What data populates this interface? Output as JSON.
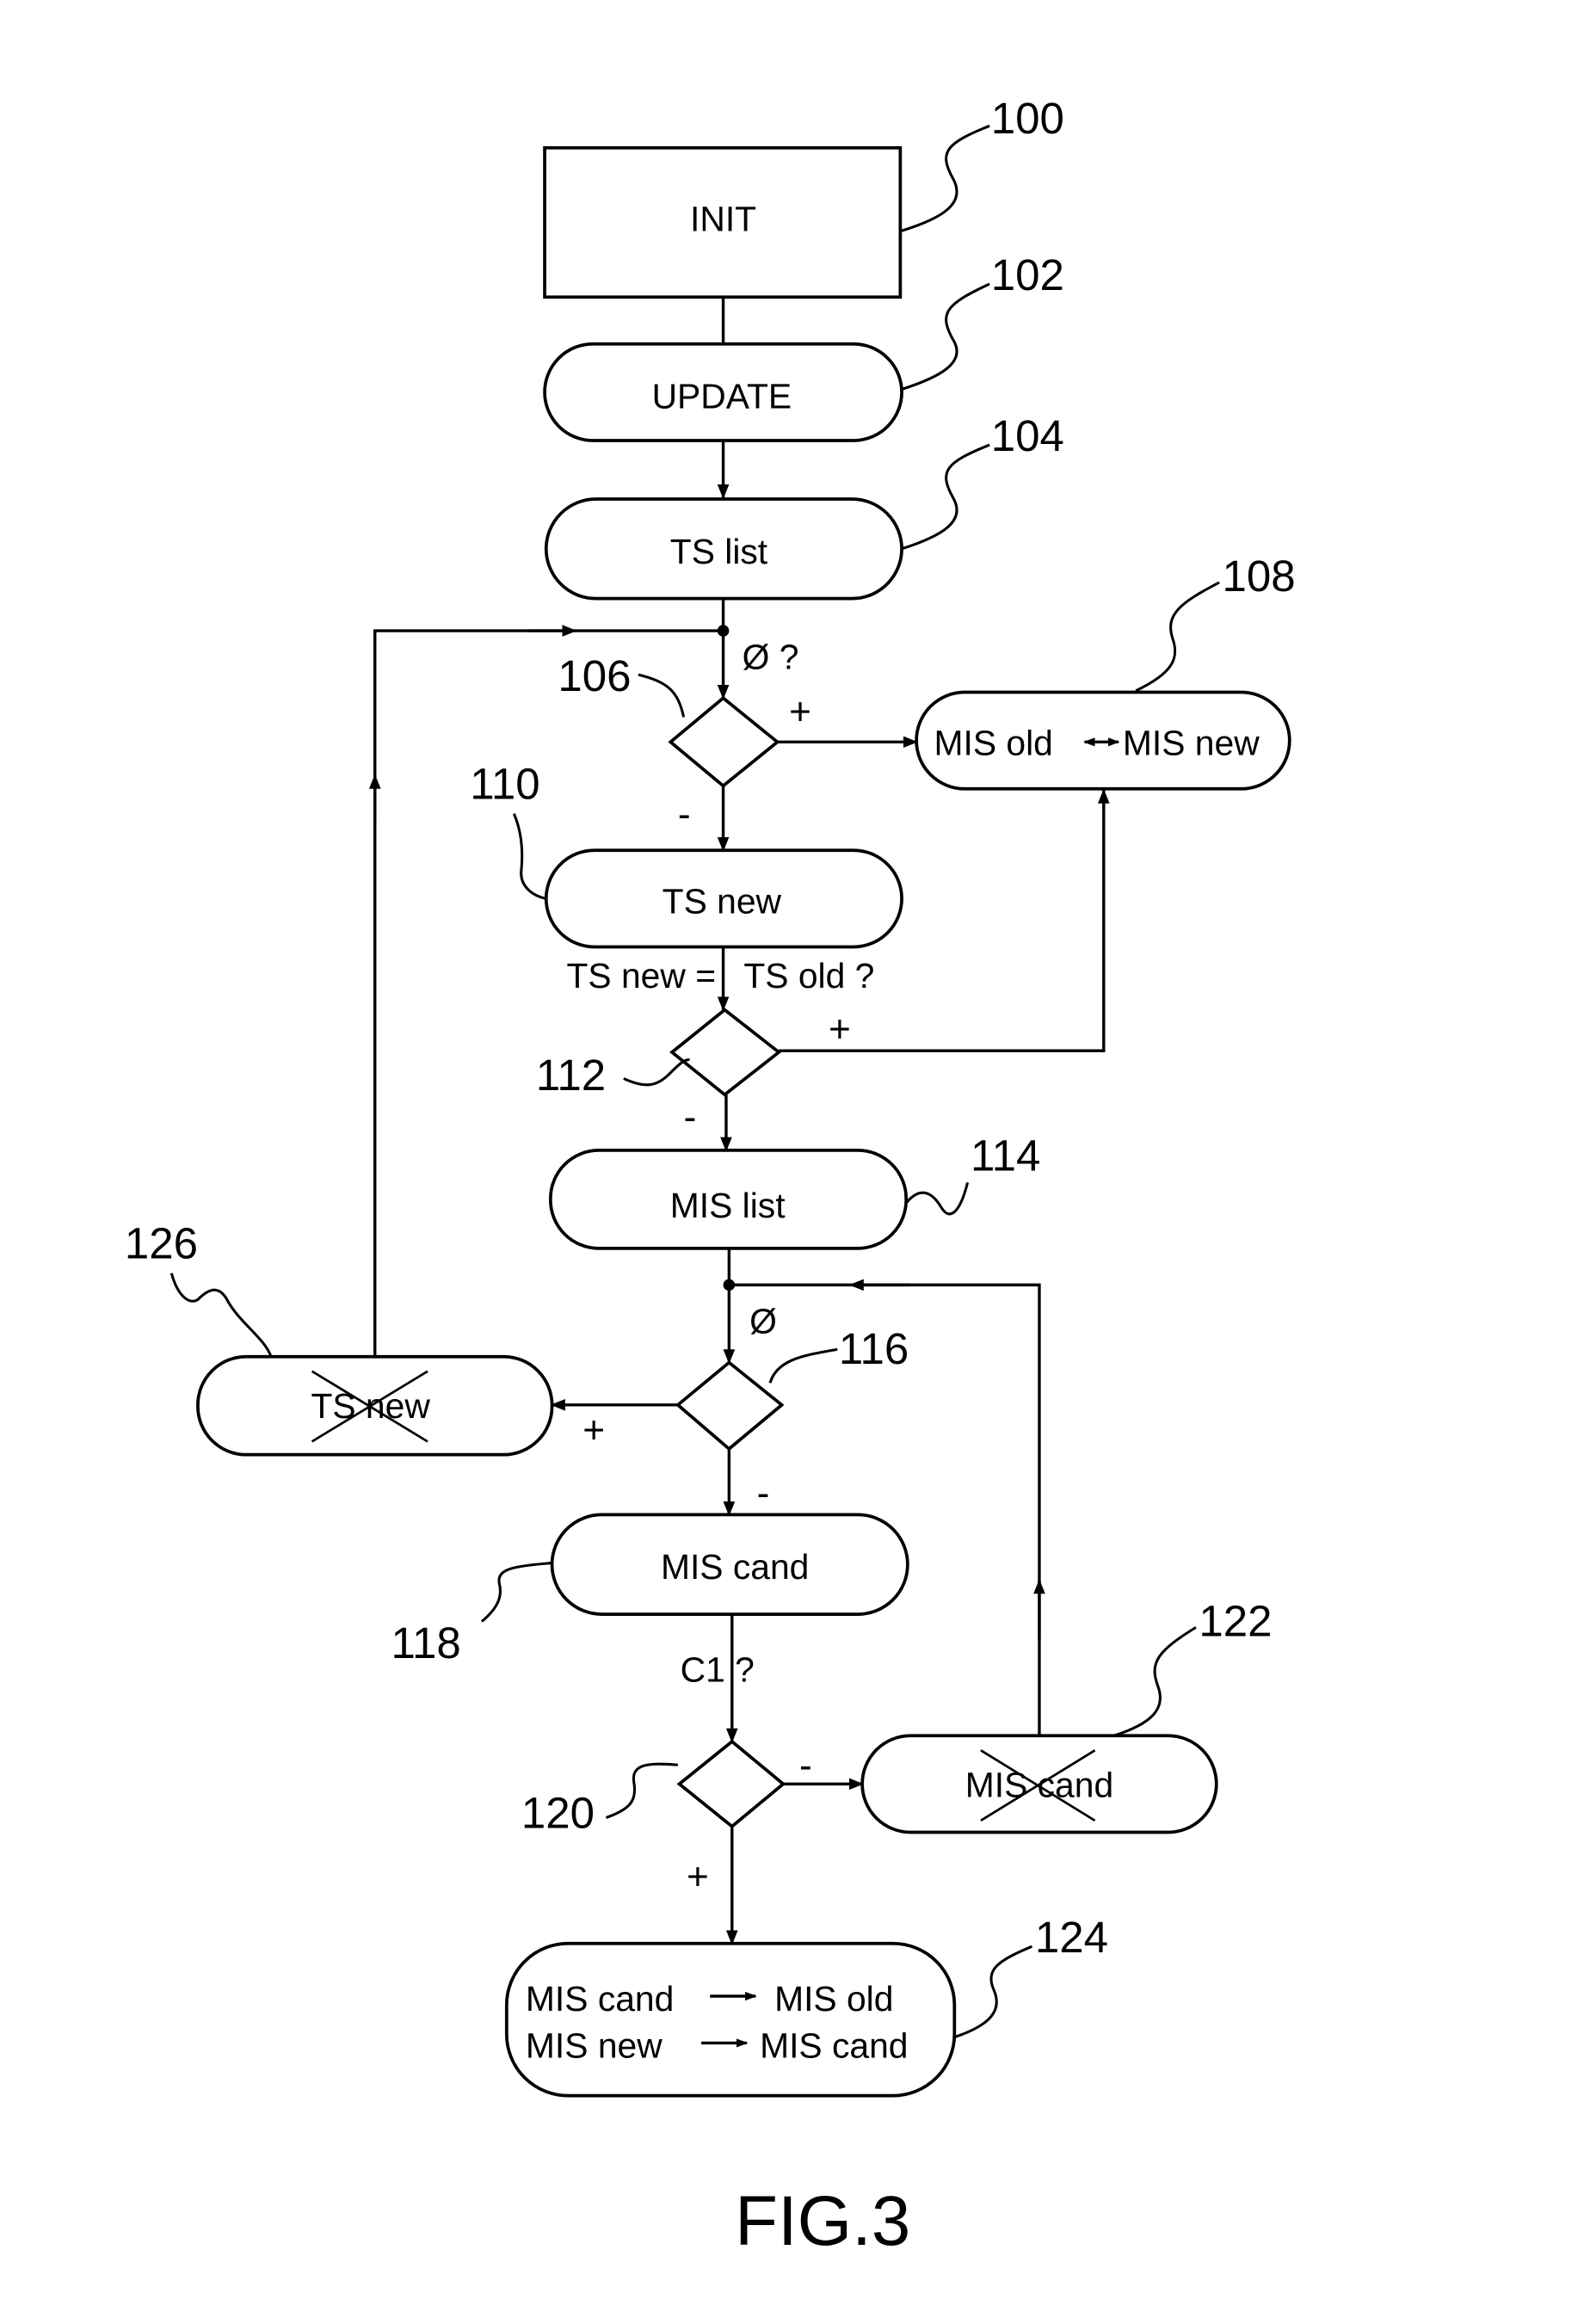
{
  "figure": {
    "caption": "FIG.3",
    "nodes": [
      {
        "id": "100",
        "label": "INIT",
        "shape": "rectangle"
      },
      {
        "id": "102",
        "label": "UPDATE",
        "shape": "rounded"
      },
      {
        "id": "104",
        "label": "TS list",
        "shape": "rounded"
      },
      {
        "id": "106",
        "label": "",
        "shape": "decision",
        "condition": "Ø ?"
      },
      {
        "id": "108",
        "label_left": "MIS old",
        "label_right": "MIS new",
        "shape": "rounded",
        "connector": "double-arrow"
      },
      {
        "id": "110",
        "label": "TS new",
        "shape": "rounded"
      },
      {
        "id": "112",
        "label": "",
        "shape": "decision",
        "condition_left": "TS new =",
        "condition_right": "TS old ?"
      },
      {
        "id": "114",
        "label": "MIS list",
        "shape": "rounded"
      },
      {
        "id": "116",
        "label": "",
        "shape": "decision",
        "condition": "Ø"
      },
      {
        "id": "118",
        "label": "MIS cand",
        "shape": "rounded"
      },
      {
        "id": "120",
        "label": "",
        "shape": "decision",
        "condition": "C1 ?"
      },
      {
        "id": "122",
        "label": "MIS cand",
        "shape": "rounded",
        "crossed_out": true
      },
      {
        "id": "124",
        "line1_left": "MIS cand",
        "line1_right": "MIS old",
        "line2_left": "MIS new",
        "line2_right": "MIS cand",
        "shape": "rounded"
      },
      {
        "id": "126",
        "label": "TS new",
        "shape": "rounded",
        "crossed_out": true
      }
    ],
    "edge_signs": {
      "d106_yes": "+",
      "d106_no": "-",
      "d112_yes": "+",
      "d112_no": "-",
      "d116_yes": "+",
      "d116_no": "-",
      "d120_yes": "+",
      "d120_no": "-"
    },
    "edges": [
      {
        "from": "100",
        "to": "102"
      },
      {
        "from": "102",
        "to": "104"
      },
      {
        "from": "104",
        "to": "106"
      },
      {
        "from": "106",
        "to": "108",
        "sign": "+"
      },
      {
        "from": "106",
        "to": "110",
        "sign": "-"
      },
      {
        "from": "110",
        "to": "112"
      },
      {
        "from": "112",
        "to": "108",
        "sign": "+"
      },
      {
        "from": "112",
        "to": "114",
        "sign": "-"
      },
      {
        "from": "114",
        "to": "116"
      },
      {
        "from": "116",
        "to": "126",
        "sign": "+"
      },
      {
        "from": "116",
        "to": "118",
        "sign": "-"
      },
      {
        "from": "118",
        "to": "120"
      },
      {
        "from": "120",
        "to": "122",
        "sign": "-"
      },
      {
        "from": "120",
        "to": "124",
        "sign": "+"
      },
      {
        "from": "122",
        "to": "116"
      },
      {
        "from": "126",
        "to": "106"
      }
    ]
  }
}
